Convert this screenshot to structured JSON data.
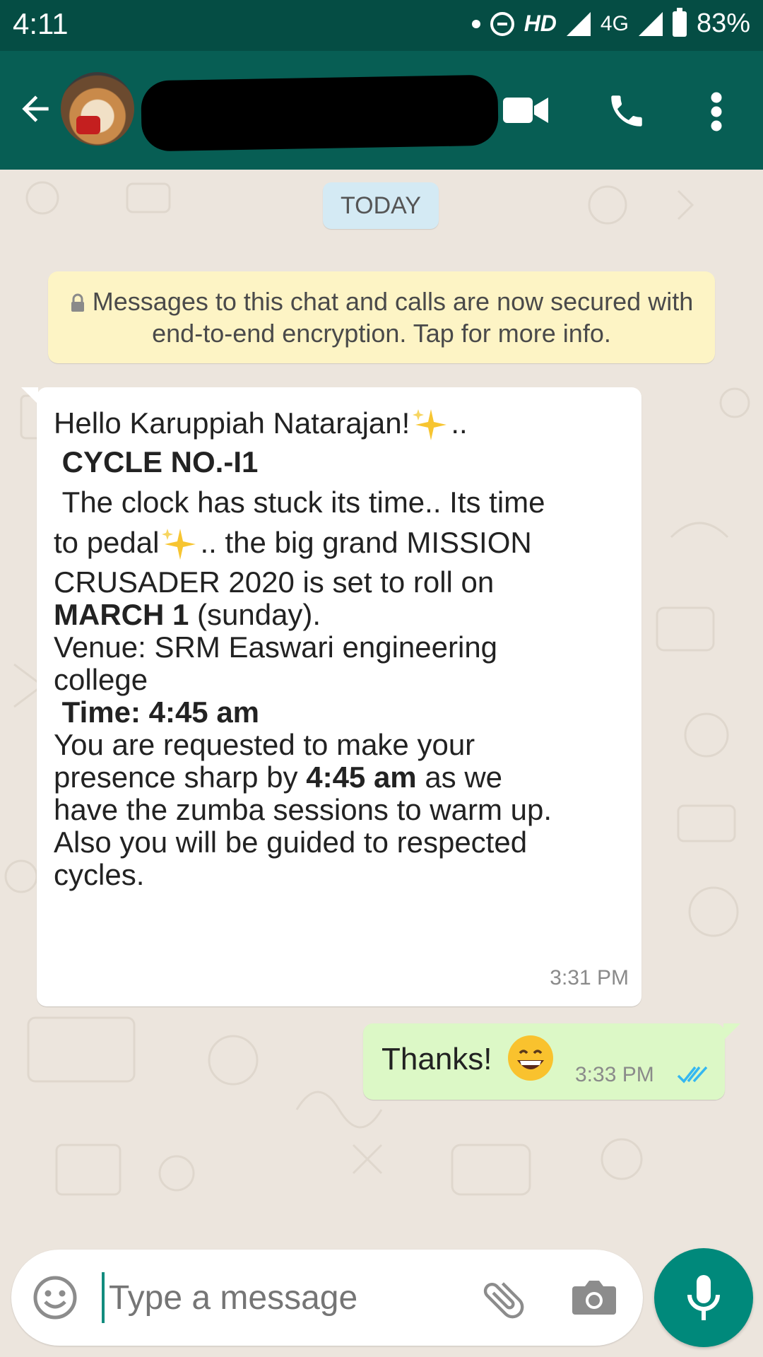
{
  "status_bar": {
    "time": "4:11",
    "hd": "HD",
    "network": "4G",
    "battery": "83%"
  },
  "header": {
    "contact_name": "",
    "icons": [
      "back-arrow-icon",
      "video-call-icon",
      "voice-call-icon",
      "more-options-icon"
    ]
  },
  "chat": {
    "date_chip": "TODAY",
    "encryption_notice": "Messages to this chat and calls are now secured with end-to-end encryption. Tap for more info.",
    "incoming": {
      "line1": "Hello Karuppiah Natarajan!",
      "line1_suffix": "..",
      "heading": " CYCLE NO.-I1",
      "line3": " The clock has stuck its time.. Its time",
      "line4a": "to pedal",
      "line4b": ".. the big grand MISSION",
      "line5": "CRUSADER 2020 is set to roll on",
      "date_bold": "MARCH 1",
      "date_rest": " (sunday).",
      "venue1": "Venue: SRM Easwari engineering",
      "venue2": "college",
      "time_bold": " Time: 4:45 am",
      "req1": "You are requested to make your",
      "req2a": "presence sharp by ",
      "req2b": "4:45 am",
      "req2c": " as we",
      "req3": "have the zumba sessions to warm up.",
      "req4": "Also you will be guided to respected",
      "req5": "cycles.",
      "timestamp": "3:31 PM"
    },
    "outgoing": {
      "text": "Thanks!",
      "timestamp": "3:33 PM",
      "status": "read"
    }
  },
  "input": {
    "placeholder": "Type a message"
  },
  "colors": {
    "status_bar": "#054d44",
    "app_bar": "#075e54",
    "chat_bg": "#ece5dd",
    "incoming_bubble": "#ffffff",
    "outgoing_bubble": "#dcf8c6",
    "notice_bg": "#fdf4c5",
    "date_chip_bg": "#d4eaf4",
    "mic_button": "#00897b",
    "read_ticks": "#34b7f1"
  }
}
